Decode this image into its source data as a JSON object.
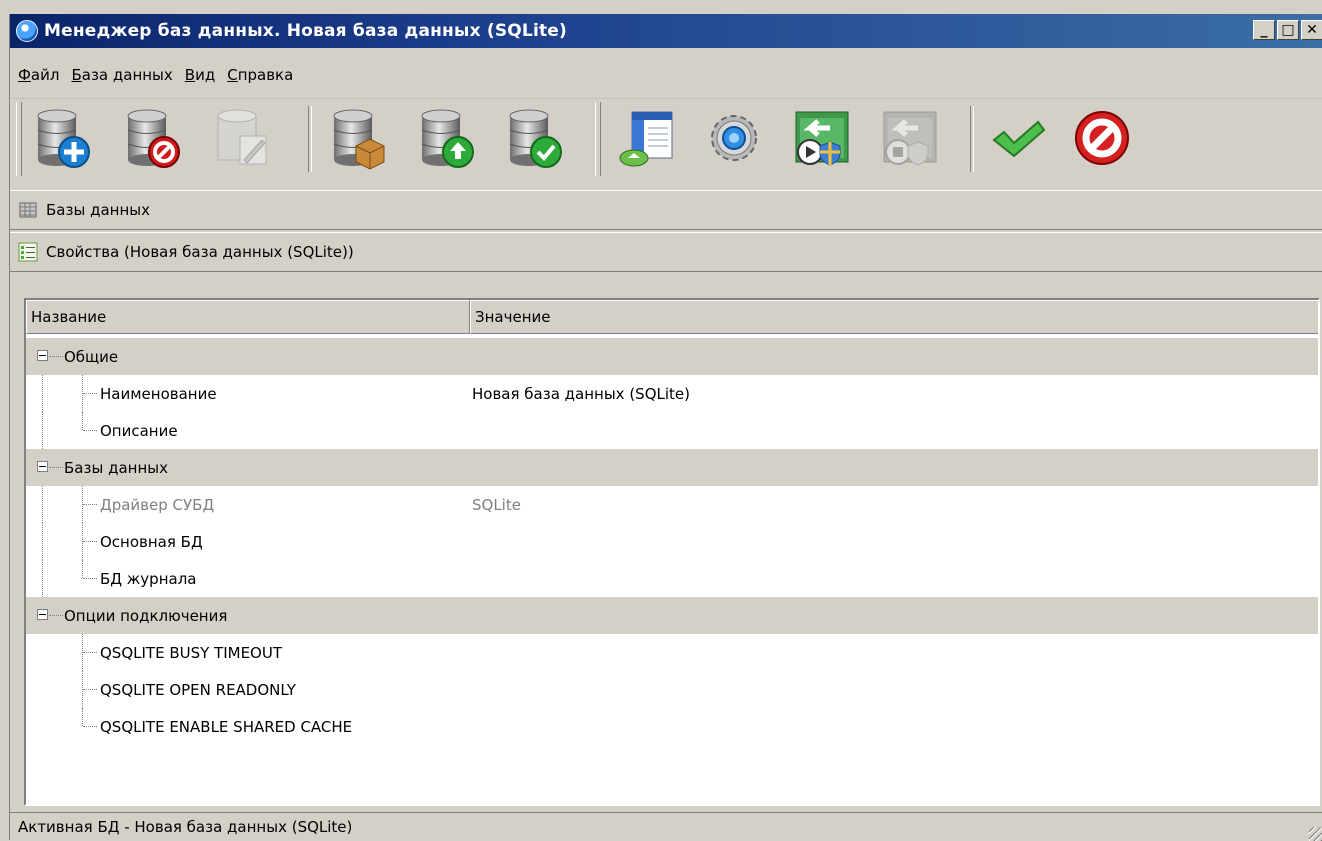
{
  "window": {
    "title": "Менеджер баз данных. Новая база данных (SQLite)",
    "controls": {
      "minimize": "_",
      "maximize": "□",
      "close": "✕"
    }
  },
  "menu": [
    {
      "label": "Файл",
      "mnemonic": "Ф",
      "rest": "айл"
    },
    {
      "label": "База данных",
      "mnemonic": "Б",
      "rest": "аза данных"
    },
    {
      "label": "Вид",
      "mnemonic": "В",
      "rest": "ид"
    },
    {
      "label": "Справка",
      "mnemonic": "С",
      "rest": "правка"
    }
  ],
  "toolbar": {
    "buttons": [
      {
        "icon": "add-database-icon",
        "enabled": true
      },
      {
        "icon": "remove-database-icon",
        "enabled": true
      },
      {
        "icon": "edit-database-icon",
        "enabled": false
      },
      {
        "icon": "backup-database-icon",
        "enabled": true
      },
      {
        "icon": "upload-database-icon",
        "enabled": true
      },
      {
        "icon": "check-database-icon",
        "enabled": true
      },
      {
        "icon": "open-form-icon",
        "enabled": true
      },
      {
        "icon": "settings-gear-icon",
        "enabled": true
      },
      {
        "icon": "connect-icon",
        "enabled": true
      },
      {
        "icon": "disconnect-icon",
        "enabled": false
      },
      {
        "icon": "apply-checkmark-icon",
        "enabled": true
      },
      {
        "icon": "cancel-icon",
        "enabled": true
      }
    ]
  },
  "sections": {
    "databases": "Базы данных",
    "properties": "Свойства (Новая база данных (SQLite))"
  },
  "table": {
    "columns": [
      "Название",
      "Значение"
    ],
    "groups": [
      {
        "label": "Общие",
        "items": [
          {
            "name": "Наименование",
            "value": "Новая база данных (SQLite)",
            "disabled": false
          },
          {
            "name": "Описание",
            "value": "",
            "disabled": false
          }
        ]
      },
      {
        "label": "Базы данных",
        "items": [
          {
            "name": "Драйвер СУБД",
            "value": "SQLite",
            "disabled": true
          },
          {
            "name": "Основная БД",
            "value": "",
            "disabled": false
          },
          {
            "name": "БД журнала",
            "value": "",
            "disabled": false
          }
        ]
      },
      {
        "label": "Опции подключения",
        "items": [
          {
            "name": "QSQLITE BUSY TIMEOUT",
            "value": "",
            "disabled": false
          },
          {
            "name": "QSQLITE OPEN READONLY",
            "value": "",
            "disabled": false
          },
          {
            "name": "QSQLITE ENABLE SHARED CACHE",
            "value": "",
            "disabled": false
          }
        ]
      }
    ]
  },
  "status": {
    "text": "Активная БД - Новая база данных (SQLite)"
  },
  "colors": {
    "title_gradient_start": "#0a246a",
    "title_gradient_end": "#3a6ea5",
    "face": "#d4d0c8",
    "disabled_text": "#808080"
  }
}
